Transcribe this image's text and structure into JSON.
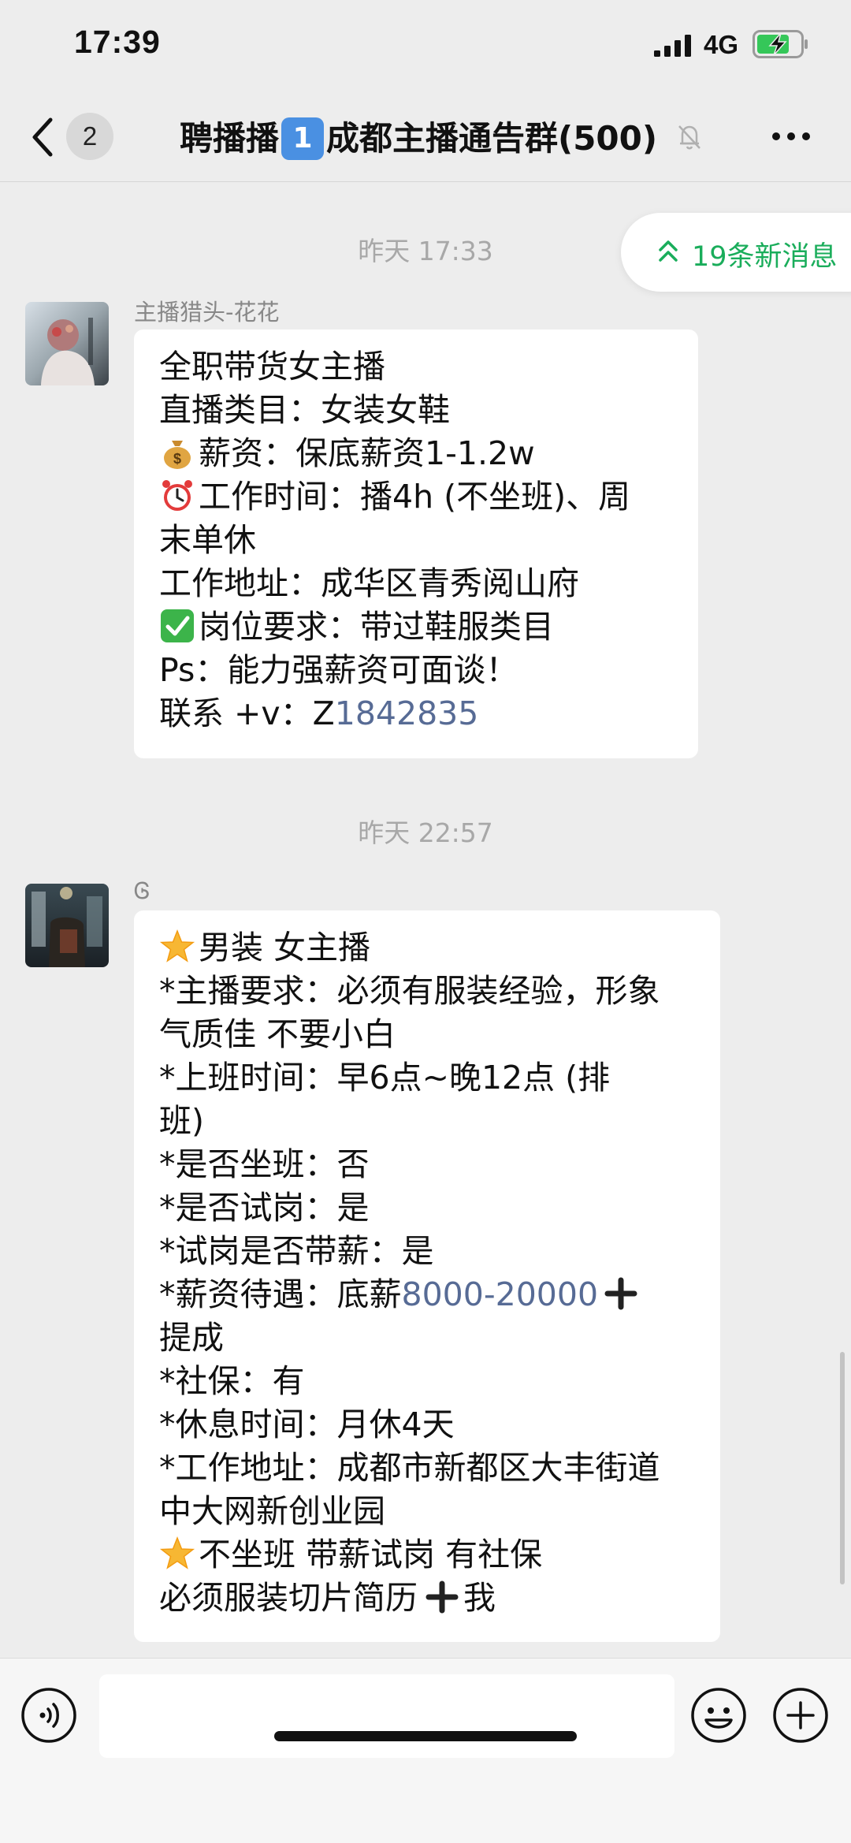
{
  "status_bar": {
    "time": "17:39",
    "network": "4G",
    "icons": [
      "signal-icon",
      "battery-charging-icon"
    ]
  },
  "nav": {
    "back_icon": "chevron-left-icon",
    "unread_count": "2",
    "title_prefix": "聘播播",
    "title_number_emoji": "1",
    "title_suffix": "成都主播通告群(500)",
    "mute_icon": "bell-muted-icon",
    "more_icon": "more-horizontal-icon"
  },
  "new_messages": {
    "icon": "double-chevron-up-icon",
    "label": "19条新消息",
    "color": "#1aad5b"
  },
  "messages": [
    {
      "timestamp": "昨天 17:33",
      "sender": "主播猎头-花花",
      "lines": [
        {
          "emoji": "",
          "text": "全职带货女主播"
        },
        {
          "emoji": "",
          "text": "直播类目：女装女鞋"
        },
        {
          "emoji": "moneybag",
          "text": "薪资：保底薪资1-1.2w"
        },
        {
          "emoji": "alarm",
          "text": "工作时间：播4h (不坐班)、周"
        },
        {
          "emoji": "",
          "text": "末单休"
        },
        {
          "emoji": "",
          "text": "工作地址：成华区青秀阅山府"
        },
        {
          "emoji": "check",
          "text": "岗位要求：带过鞋服类目"
        },
        {
          "emoji": "",
          "text": "Ps：能力强薪资可面谈！"
        }
      ],
      "contact_prefix": "联系 +v：Z",
      "contact_link": "1842835"
    },
    {
      "timestamp": "昨天 22:57",
      "sender": "Ꮆ",
      "lines_before": [
        {
          "emoji": "star",
          "text": "男装 女主播"
        },
        {
          "emoji": "",
          "text": "*主播要求：必须有服装经验，形象"
        },
        {
          "emoji": "",
          "text": "气质佳 不要小白"
        },
        {
          "emoji": "",
          "text": "*上班时间：早6点~晚12点 (排"
        },
        {
          "emoji": "",
          "text": "班)"
        },
        {
          "emoji": "",
          "text": "*是否坐班：否"
        },
        {
          "emoji": "",
          "text": "*是否试岗：是"
        },
        {
          "emoji": "",
          "text": "*试岗是否带薪：是"
        }
      ],
      "salary_prefix": "*薪资待遇：底薪",
      "salary_link": "8000-20000",
      "lines_after": [
        {
          "emoji": "",
          "text": "提成"
        },
        {
          "emoji": "",
          "text": "*社保：有"
        },
        {
          "emoji": "",
          "text": "*休息时间：月休4天"
        },
        {
          "emoji": "",
          "text": "*工作地址：成都市新都区大丰街道"
        },
        {
          "emoji": "",
          "text": "中大网新创业园"
        },
        {
          "emoji": "star",
          "text": "不坐班 带薪试岗 有社保"
        }
      ],
      "last_line_text": "必须服装切片简历",
      "last_line_suffix": "我"
    }
  ],
  "input_bar": {
    "voice_icon": "voice-icon",
    "emoji_icon": "emoji-icon",
    "plus_icon": "plus-circle-icon",
    "input_value": ""
  },
  "colors": {
    "link": "#576b95",
    "background": "#ededed",
    "bubble": "#ffffff"
  }
}
